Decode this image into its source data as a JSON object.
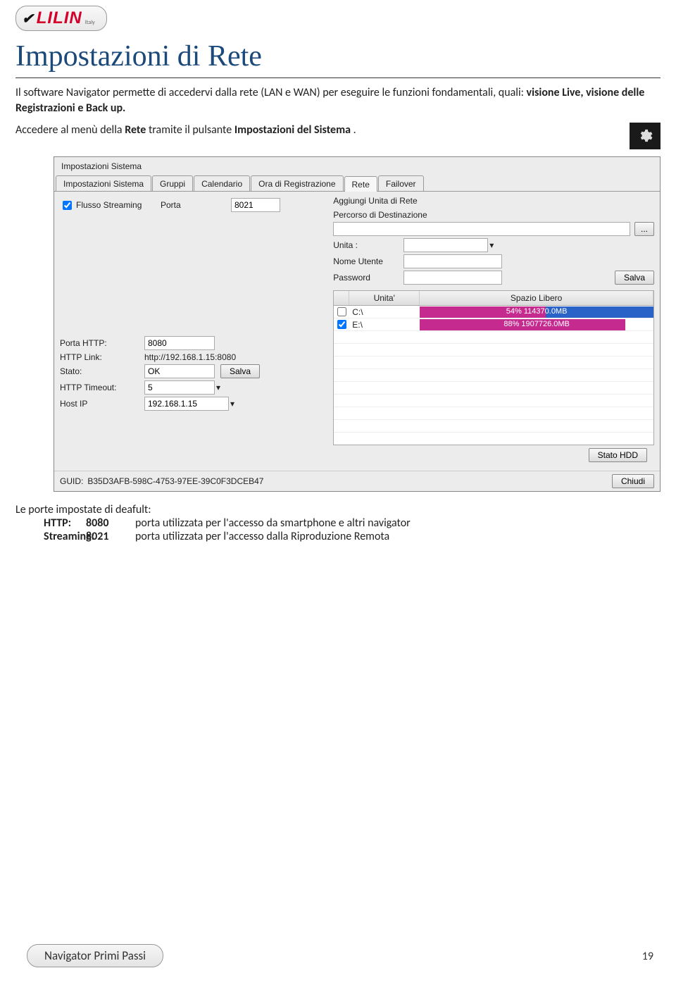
{
  "logo": {
    "brand": "LILIN",
    "sub": "Italy"
  },
  "page_title": "Impostazioni di Rete",
  "intro": {
    "part1": "Il software Navigator permette di accedervi dalla rete (LAN e WAN) per eseguire le funzioni fondamentali, quali: ",
    "bold": "visione Live, visione delle Registrazioni e Back up.",
    "line2a": "Accedere al menù della ",
    "line2bold1": "Rete",
    "line2b": " tramite il pulsante ",
    "line2bold2": "Impostazioni del Sistema",
    "line2c": "."
  },
  "dialog": {
    "title": "Impostazioni Sistema",
    "tabs": [
      "Impostazioni Sistema",
      "Gruppi",
      "Calendario",
      "Ora di Registrazione",
      "Rete",
      "Failover"
    ],
    "active_tab_index": 4,
    "left": {
      "flusso_label": "Flusso Streaming",
      "porta_label": "Porta",
      "porta_value": "8021",
      "http": {
        "porta_http_label": "Porta HTTP:",
        "porta_http_value": "8080",
        "link_label": "HTTP Link:",
        "link_value": "http://192.168.1.15:8080",
        "stato_label": "Stato:",
        "stato_value": "OK",
        "salva_btn": "Salva",
        "timeout_label": "HTTP Timeout:",
        "timeout_value": "5",
        "host_label": "Host IP",
        "host_value": "192.168.1.15"
      }
    },
    "right": {
      "aggiungi": "Aggiungi Unita di Rete",
      "percorso": "Percorso di Destinazione",
      "browse": "...",
      "unita_label": "Unita :",
      "nome_utente_label": "Nome Utente",
      "password_label": "Password",
      "salva_btn": "Salva",
      "grid": {
        "head_unit": "Unita'",
        "head_free": "Spazio Libero",
        "rows": [
          {
            "checked": false,
            "unit": "C:\\",
            "pct": 54,
            "text": "54%    114370.0MB"
          },
          {
            "checked": true,
            "unit": "E:\\",
            "pct": 88,
            "text": "88%    1907726.0MB"
          }
        ]
      },
      "stato_hdd": "Stato HDD"
    },
    "guid_label": "GUID:",
    "guid_value": "B35D3AFB-598C-4753-97EE-39C0F3DCEB47",
    "close_btn": "Chiudi"
  },
  "defaults": {
    "title": "Le porte impostate di deafult:",
    "rows": [
      {
        "k": "HTTP:",
        "v": "8080",
        "d": "porta utilizzata per l'accesso da smartphone e altri navigator"
      },
      {
        "k": "Streaming:",
        "v": "8021",
        "d": "porta utilizzata per l'accesso dalla Riproduzione Remota"
      }
    ]
  },
  "footer": {
    "label": "Navigator Primi Passi",
    "page": "19"
  }
}
